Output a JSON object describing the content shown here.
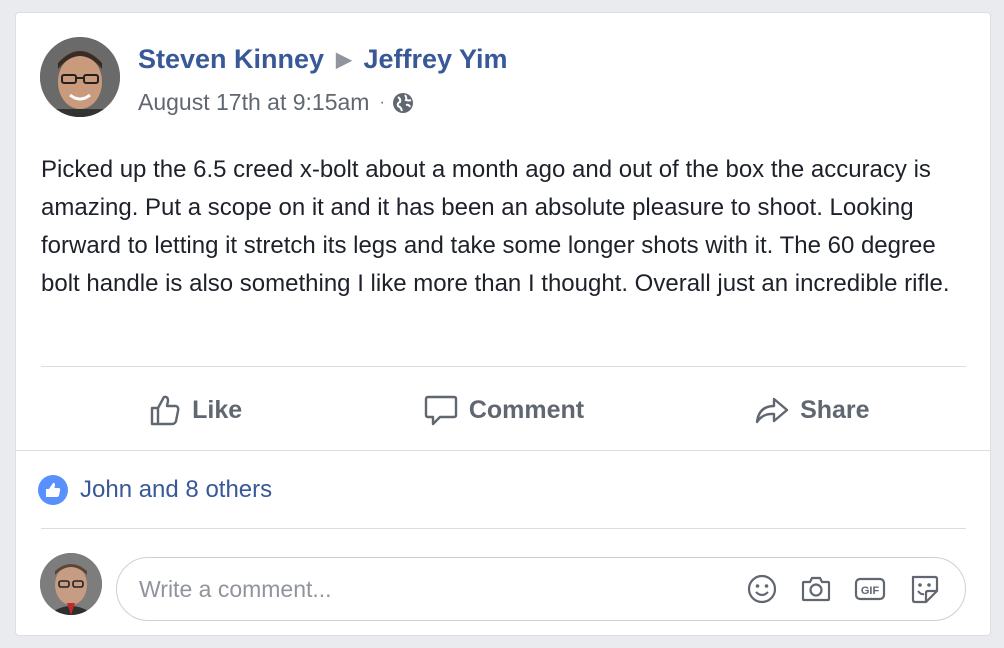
{
  "post": {
    "author": "Steven Kinney",
    "recipient": "Jeffrey Yim",
    "timestamp": "August 17th at 9:15am",
    "separator_dot": "·",
    "privacy_icon": "globe-icon",
    "body": "Picked up the 6.5 creed x-bolt about a month ago and out of the box the accuracy is amazing. Put a scope on it and it has been an absolute pleasure to shoot. Looking forward to letting it stretch its legs and take some longer shots with it. The 60 degree bolt handle is also something I like more than I thought. Overall just an incredible rifle."
  },
  "actions": {
    "like": "Like",
    "comment": "Comment",
    "share": "Share"
  },
  "reactions": {
    "icon": "like-badge-icon",
    "text": "John and 8 others"
  },
  "comment_input": {
    "placeholder": "Write a comment...",
    "value": "",
    "icons": [
      "emoji-icon",
      "camera-icon",
      "gif-icon",
      "sticker-icon"
    ]
  },
  "colors": {
    "link": "#385898",
    "muted": "#616770",
    "like_badge": "#5890ff",
    "background": "#e9ebee"
  }
}
